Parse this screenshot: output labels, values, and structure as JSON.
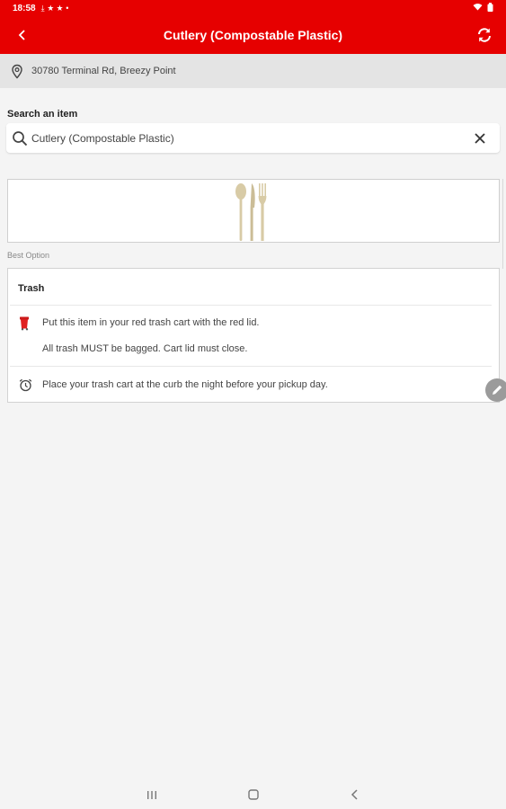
{
  "status_bar": {
    "time": "18:58",
    "notification_icons": [
      "download-icon",
      "star-icon",
      "star-icon",
      "dot-icon"
    ],
    "system_icons": [
      "wifi-icon",
      "battery-icon"
    ]
  },
  "app_bar": {
    "title": "Cutlery (Compostable Plastic)",
    "back_icon": "back-arrow-icon",
    "refresh_icon": "refresh-icon",
    "background_color": "#e60000"
  },
  "address": {
    "icon": "location-pin-icon",
    "text": "30780 Terminal Rd, Breezy Point"
  },
  "search": {
    "label": "Search an item",
    "value": "Cutlery (Compostable Plastic)",
    "search_icon": "search-icon",
    "clear_icon": "close-icon"
  },
  "item_image": {
    "icon": "cutlery-icon",
    "color": "#d8cba6"
  },
  "best_option_label": "Best Option",
  "disposal_card": {
    "title": "Trash",
    "instructions": [
      {
        "icon": "red-trash-cart-icon",
        "lines": [
          "Put this item in your red trash cart with the red lid.",
          "All trash MUST be bagged. Cart lid must close."
        ]
      },
      {
        "icon": "alarm-clock-icon",
        "lines": [
          "Place your trash cart at the curb the night before your pickup day."
        ]
      }
    ]
  },
  "floating_button": {
    "icon": "edit-pencil-icon"
  },
  "nav_bar": {
    "buttons": [
      "recent-apps-icon",
      "home-icon",
      "back-icon"
    ]
  }
}
